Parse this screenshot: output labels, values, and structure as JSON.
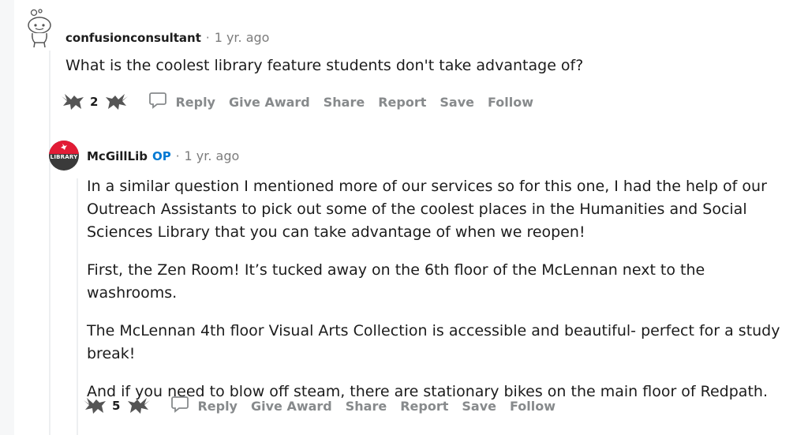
{
  "comment1": {
    "author": "confusionconsultant",
    "time": "1 yr. ago",
    "body": "What is the coolest library feature students don't take advantage of?",
    "score": "2",
    "actions": {
      "reply": "Reply",
      "give_award": "Give Award",
      "share": "Share",
      "report": "Report",
      "save": "Save",
      "follow": "Follow"
    }
  },
  "comment2": {
    "author": "McGillLib",
    "op_badge": "OP",
    "time": "1 yr. ago",
    "avatar_label": "LIBRARY",
    "paragraphs": [
      "In a similar question I mentioned more of our services so for this one, I had the help of our Outreach Assistants to pick out some of the coolest places in the Humanities and Social Sciences Library that you can take advantage of when we reopen!",
      "First, the Zen Room! It’s tucked away on the 6th floor of the McLennan next to the washrooms.",
      "The McLennan 4th floor Visual Arts Collection is accessible and beautiful- perfect for a study break!",
      "And if you need to blow off steam, there are stationary bikes on the main floor of Redpath."
    ],
    "score": "5",
    "actions": {
      "reply": "Reply",
      "give_award": "Give Award",
      "share": "Share",
      "report": "Report",
      "save": "Save",
      "follow": "Follow"
    }
  },
  "colors": {
    "op": "#0079d3",
    "muted": "#878a8c",
    "avatar_red": "#e21b35"
  },
  "icons": [
    "snoo-avatar-icon",
    "upvote-bird-icon",
    "downvote-bird-icon",
    "comment-bubble-icon",
    "library-bird-icon"
  ]
}
